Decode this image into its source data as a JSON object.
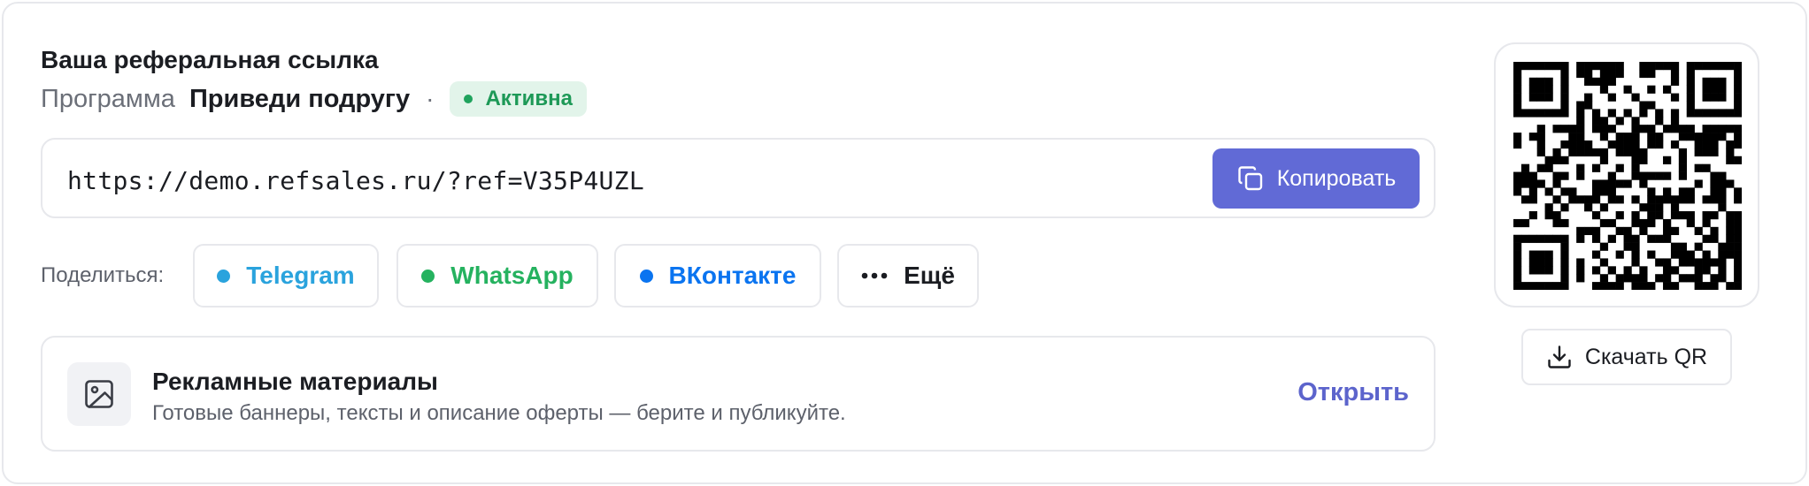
{
  "card": {
    "title": "Ваша реферальная ссылка",
    "program_label": "Программа",
    "program_name": "Приведи подругу",
    "separator": "·",
    "status": "Активна",
    "status_color": "#1fa35d"
  },
  "link": {
    "url": "https://demo.refsales.ru/?ref=V35P4UZL",
    "copy_label": "Копировать",
    "copy_icon": "copy-icon",
    "accent": "#616ad6"
  },
  "share": {
    "label": "Поделиться:",
    "options": [
      {
        "label": "Telegram",
        "color": "#2aa3dd"
      },
      {
        "label": "WhatsApp",
        "color": "#25b25f"
      },
      {
        "label": "ВКонтакте",
        "color": "#0a74f0"
      },
      {
        "label": "Ещё",
        "icon": "more-dots-icon"
      }
    ]
  },
  "materials": {
    "title": "Рекламные материалы",
    "description": "Готовые баннеры, тексты и описание оферты — берите и публикуйте.",
    "icon": "image-icon",
    "action": "Открыть"
  },
  "qr": {
    "download_label": "Скачать QR",
    "download_icon": "download-icon"
  }
}
